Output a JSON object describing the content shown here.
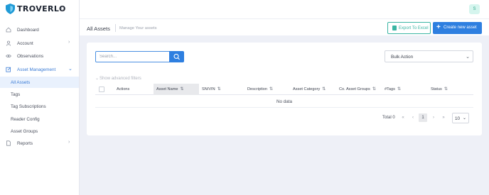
{
  "brand": {
    "name": "TROVERLO",
    "color": "#1c2330"
  },
  "user": {
    "initial": "S"
  },
  "sidebar": {
    "items": [
      {
        "label": "Dashboard",
        "icon": "home-icon"
      },
      {
        "label": "Account",
        "icon": "user-icon",
        "chevron": "›"
      },
      {
        "label": "Observations",
        "icon": "eye-icon"
      },
      {
        "label": "Asset Management",
        "icon": "edit-icon",
        "chevron": "⌄"
      },
      {
        "label": "Reports",
        "icon": "file-icon",
        "chevron": "›"
      }
    ],
    "subitems": [
      {
        "label": "All Assets"
      },
      {
        "label": "Tags"
      },
      {
        "label": "Tag Subscriptions"
      },
      {
        "label": "Reader Config"
      },
      {
        "label": "Asset Groups"
      }
    ]
  },
  "header": {
    "title": "All Assets",
    "subtitle": "Manage Your assets",
    "export_label": "Export To Excel",
    "create_label": "Create new asset",
    "create_icon": "+"
  },
  "toolbar": {
    "search_placeholder": "Search...",
    "bulk_action": "Bulk Action",
    "advanced_filters": "Show advanced filters"
  },
  "table": {
    "columns": [
      "Actions",
      "Asset Name",
      "SN/VIN",
      "Description",
      "Asset Category",
      "Co. Asset Groups",
      "#Tags",
      "Status"
    ],
    "sort_glyph": "⇅",
    "sorted_glyph": "⇅",
    "empty_text": "No data"
  },
  "pagination": {
    "total_text": "Total 0",
    "first": "«",
    "prev": "‹",
    "current_page": "1",
    "next": "›",
    "last": "»",
    "page_size": "10"
  },
  "colors": {
    "accent": "#2e7fe0",
    "export": "#3ab5a3",
    "active_bg": "#e9f1fd",
    "avatar_bg": "#d5f5ee"
  }
}
